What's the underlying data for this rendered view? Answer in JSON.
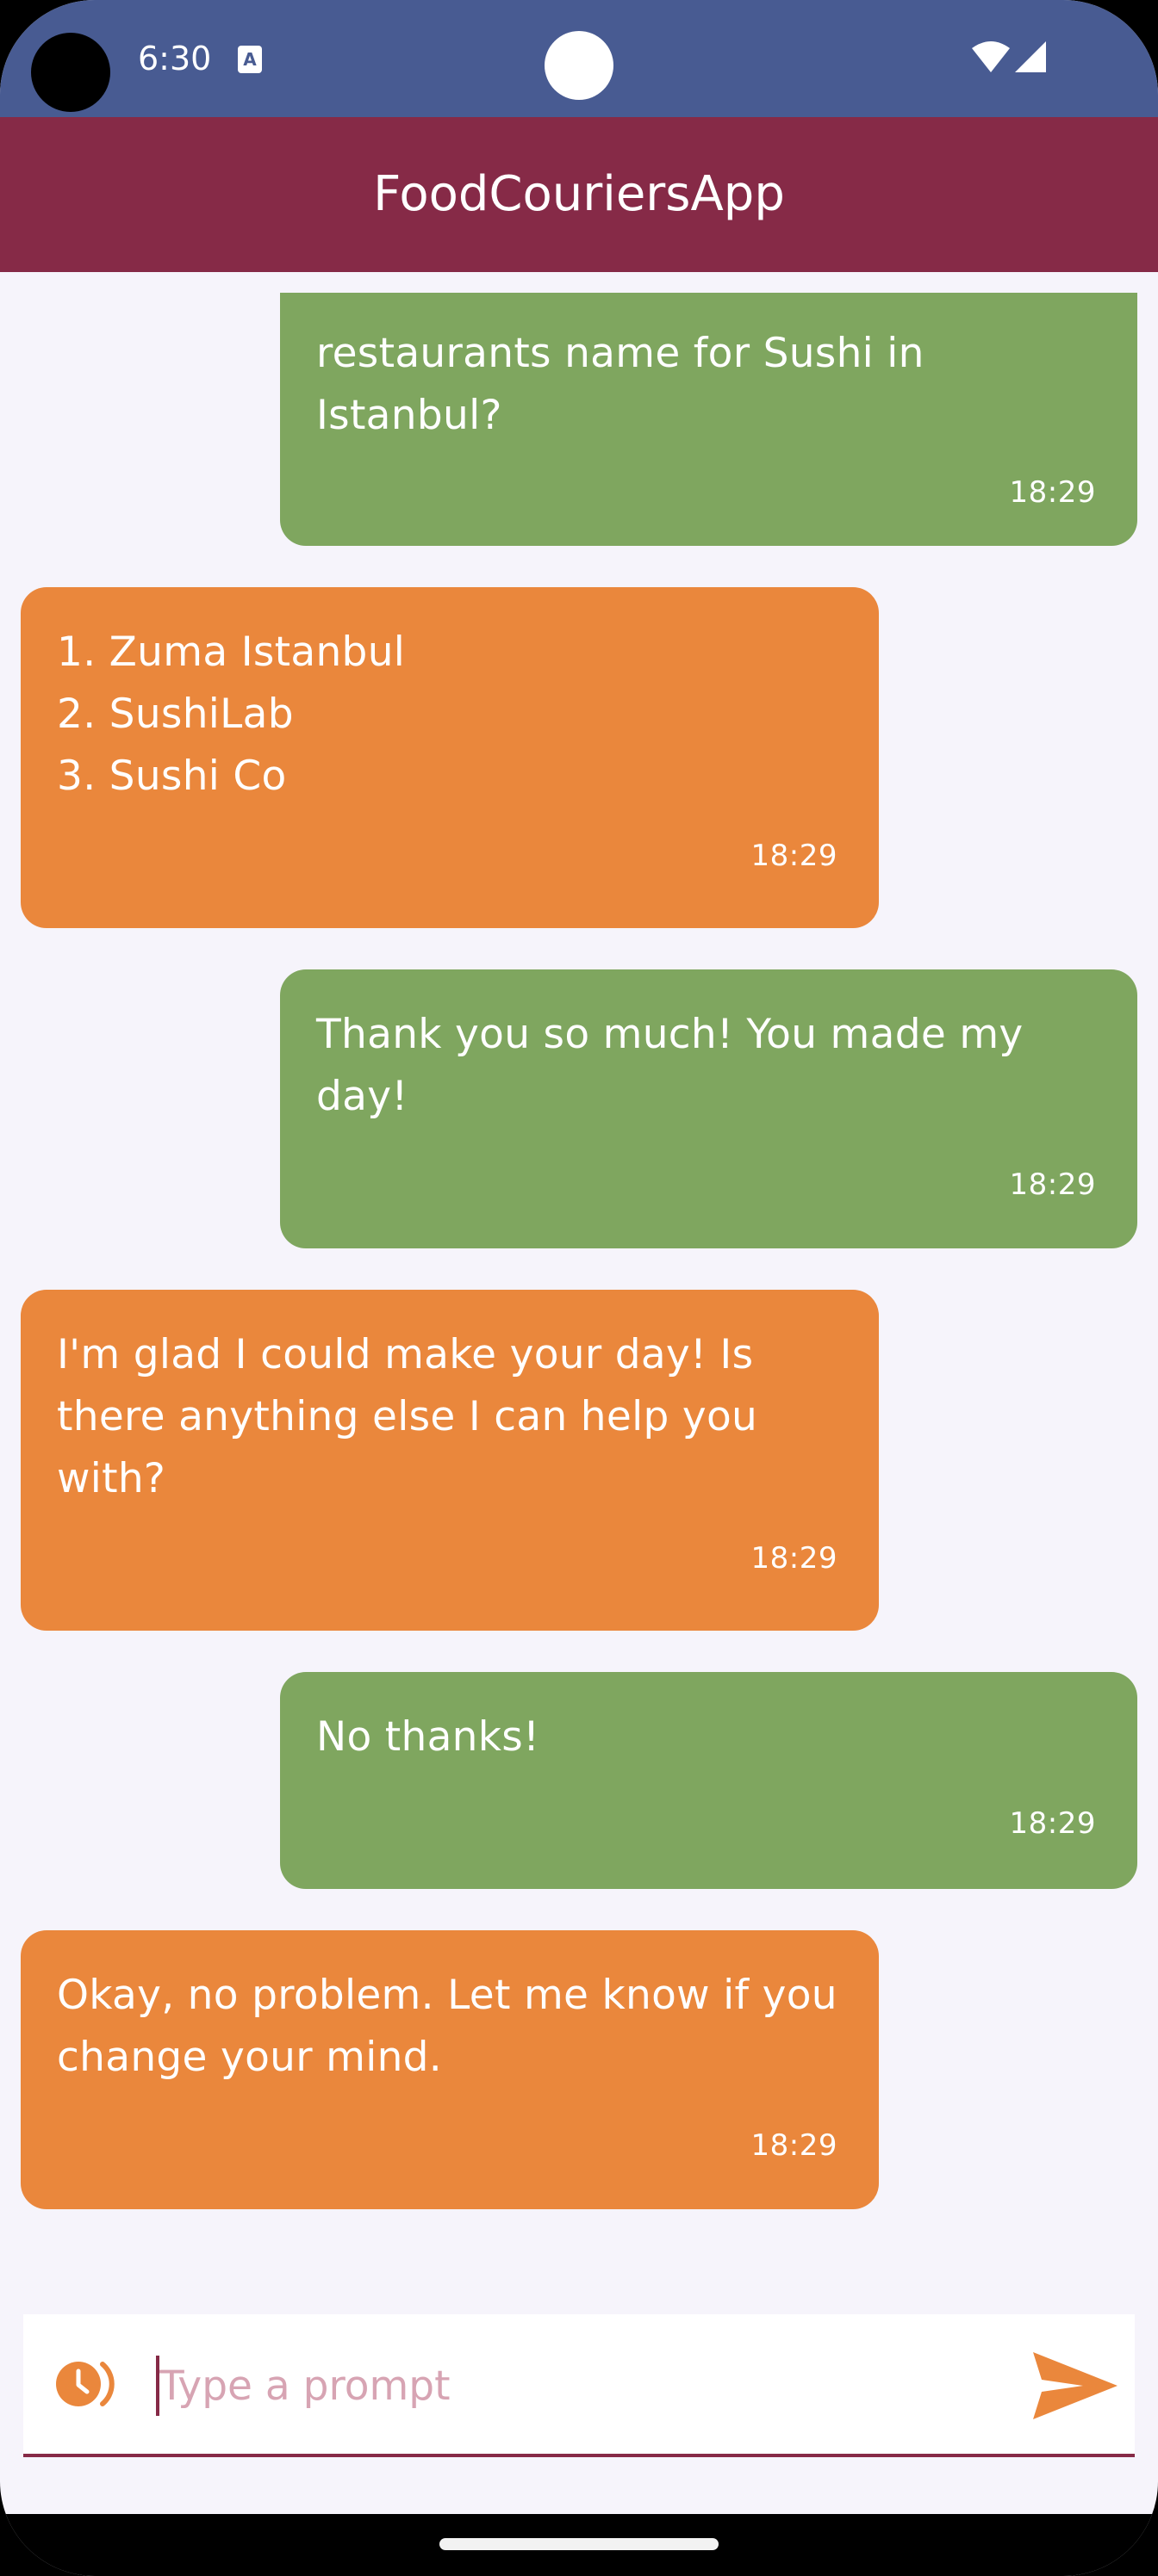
{
  "status_bar": {
    "time": "6:30",
    "icons": [
      "a-notification-icon",
      "wifi-icon",
      "signal-icon"
    ]
  },
  "app_bar": {
    "title": "FoodCouriersApp"
  },
  "colors": {
    "status_bar": "#485b92",
    "app_bar": "#862a47",
    "user_bubble": "#7fa65f",
    "bot_bubble": "#ea873c",
    "background": "#f6f4fb",
    "accent": "#ea873c"
  },
  "messages": [
    {
      "sender": "user",
      "text": "restaurants name for Sushi in\nIstanbul?",
      "time": "18:29"
    },
    {
      "sender": "bot",
      "text": "1. Zuma Istanbul\n2. SushiLab\n3. Sushi Co",
      "time": "18:29"
    },
    {
      "sender": "user",
      "text": "Thank you so much! You made my\nday!",
      "time": "18:29"
    },
    {
      "sender": "bot",
      "text": "I'm glad I could make your day! Is\nthere anything else I can help you\nwith?",
      "time": "18:29"
    },
    {
      "sender": "user",
      "text": "No thanks!",
      "time": "18:29"
    },
    {
      "sender": "bot",
      "text": "Okay, no problem. Let me know if you\nchange your mind.",
      "time": "18:29"
    }
  ],
  "input": {
    "placeholder": "Type a prompt",
    "value": ""
  },
  "icons": {
    "history": "history-icon",
    "send": "send-icon"
  }
}
